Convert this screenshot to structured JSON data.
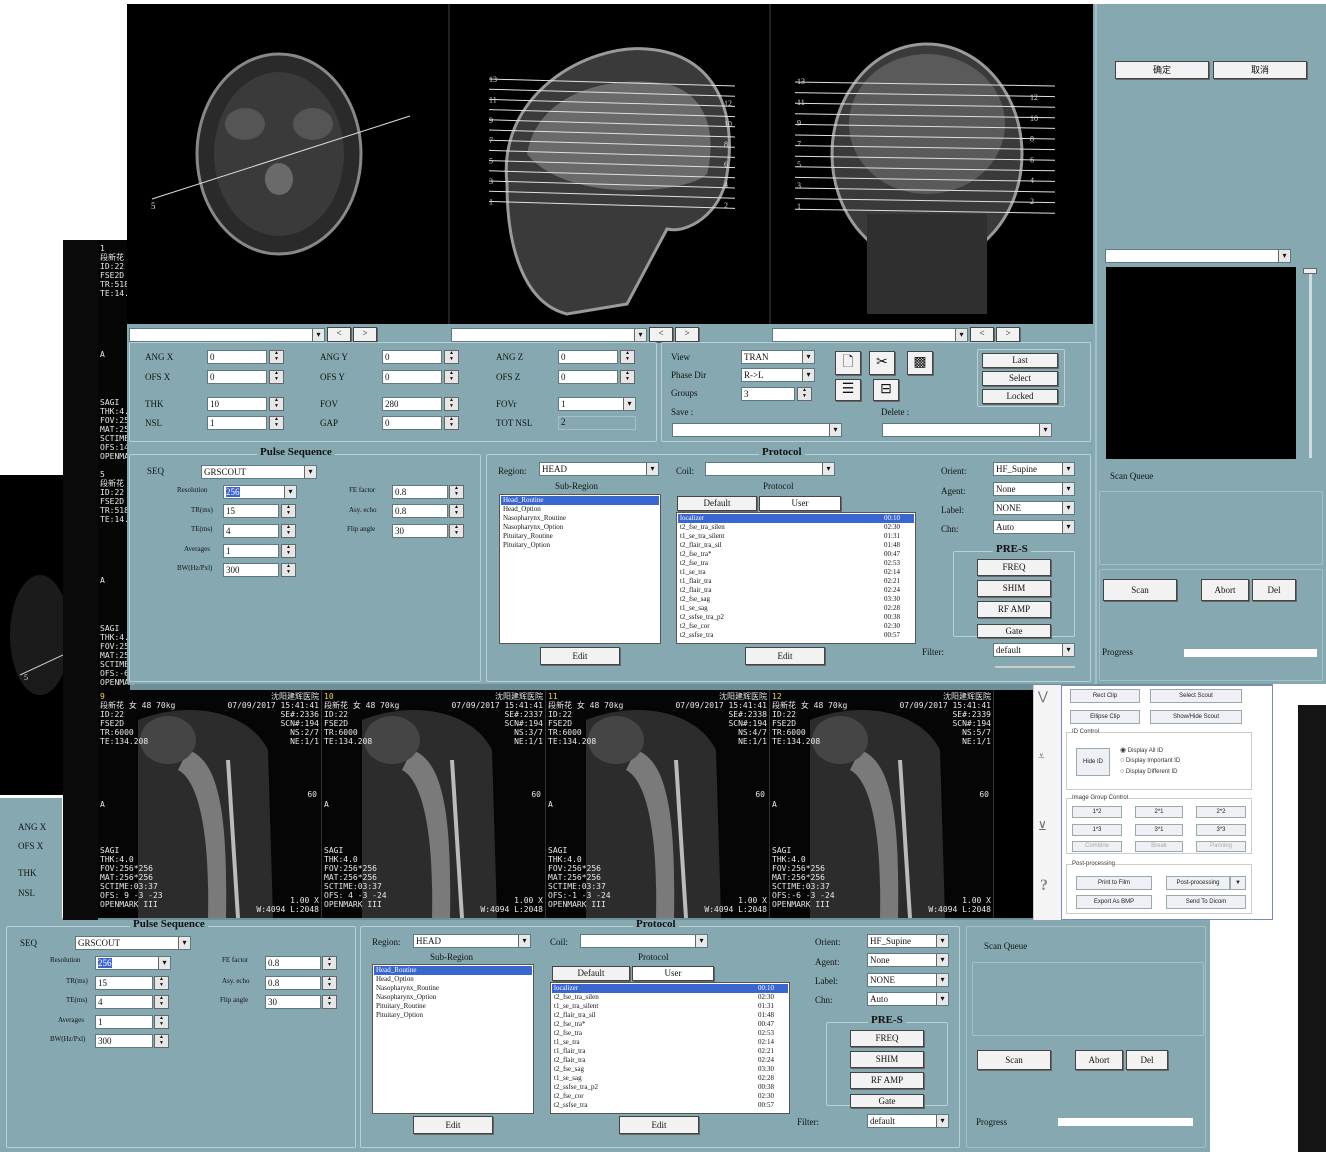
{
  "top_right": {
    "ok_label": "确定",
    "cancel_label": "取消",
    "scan_queue_label": "Scan Queue",
    "scan_label": "Scan",
    "abort_label": "Abort",
    "del_label": "Del",
    "progress_label": "Progress"
  },
  "planning": {
    "ang_x": "ANG X",
    "ang_x_val": "0",
    "ang_y": "ANG Y",
    "ang_y_val": "0",
    "ang_z": "ANG Z",
    "ang_z_val": "0",
    "ofs_x": "OFS X",
    "ofs_x_val": "0",
    "ofs_y": "OFS Y",
    "ofs_y_val": "0",
    "ofs_z": "OFS Z",
    "ofs_z_val": "0",
    "thk": "THK",
    "thk_val": "10",
    "fov": "FOV",
    "fov_val": "280",
    "fovr": "FOVr",
    "fovr_val": "1",
    "nsl": "NSL",
    "nsl_val": "1",
    "gap": "GAP",
    "gap_val": "0",
    "tot_nsl": "TOT NSL",
    "tot_nsl_val": "2",
    "view": "View",
    "view_val": "TRAN",
    "phase_dir": "Phase Dir",
    "phase_dir_val": "R->L",
    "groups": "Groups",
    "groups_val": "3",
    "save": "Save :",
    "delete": "Delete :",
    "last": "Last",
    "select": "Select",
    "locked": "Locked"
  },
  "pulse": {
    "title": "Pulse Sequence",
    "seq": "SEQ",
    "seq_val": "GRSCOUT",
    "resolution": "Resolution",
    "resolution_val": "256",
    "tr": "TR(ms)",
    "tr_val": "15",
    "te": "TE(ms)",
    "te_val": "4",
    "averages": "Averages",
    "averages_val": "1",
    "bw": "BW(Hz/Pxl)",
    "bw_val": "300",
    "fe": "FE factor",
    "fe_val": "0.8",
    "asy": "Asy. echo",
    "asy_val": "0.8",
    "flip": "Flip angle",
    "flip_val": "30"
  },
  "protocol": {
    "title": "Protocol",
    "region": "Region:",
    "region_val": "HEAD",
    "subregion": "Sub-Region",
    "coil": "Coil:",
    "protocol_hdr": "Protocol",
    "default": "Default",
    "user": "User",
    "edit": "Edit",
    "subregions": [
      "Head_Routine",
      "Head_Option",
      "Nasopharynx_Routine",
      "Nasopharynx_Option",
      "Pituitary_Routine",
      "Pituitary_Option"
    ],
    "items": [
      {
        "name": "localizer",
        "time": "00:10"
      },
      {
        "name": "t2_fse_tra_silen",
        "time": "02:30"
      },
      {
        "name": "t1_se_tra_silent",
        "time": "01:31"
      },
      {
        "name": "t2_flair_tra_sil",
        "time": "01:48"
      },
      {
        "name": "t2_fse_tra*",
        "time": "00:47"
      },
      {
        "name": "t2_fse_tra",
        "time": "02:53"
      },
      {
        "name": "t1_se_tra",
        "time": "02:14"
      },
      {
        "name": "t1_flair_tra",
        "time": "02:21"
      },
      {
        "name": "t2_flair_tra",
        "time": "02:24"
      },
      {
        "name": "t2_fse_sag",
        "time": "03:30"
      },
      {
        "name": "t1_se_sag",
        "time": "02:28"
      },
      {
        "name": "t2_ssfse_tra_p2",
        "time": "00:38"
      },
      {
        "name": "t2_fse_cor",
        "time": "02:30"
      },
      {
        "name": "t2_ssfse_tra",
        "time": "00:57"
      }
    ],
    "orient": "Orient:",
    "orient_val": "HF_Supine",
    "agent": "Agent:",
    "agent_val": "None",
    "label": "Label:",
    "label_val": "NONE",
    "chn": "Chn:",
    "chn_val": "Auto",
    "pres": "PRE-S",
    "freq": "FREQ",
    "shim": "SHIM",
    "rfamp": "RF AMP",
    "gate": "Gate",
    "filter": "Filter:",
    "filter_val": "default"
  },
  "slice_labels": {
    "sag_left": [
      "13",
      "11",
      "9",
      "7",
      "5",
      "3",
      "1"
    ],
    "sag_right": [
      "12",
      "10",
      "8",
      "6",
      "4",
      "2"
    ],
    "cor_left": [
      "13",
      "11",
      "9",
      "7",
      "5",
      "3",
      "1"
    ],
    "cor_right": [
      "12",
      "10",
      "8",
      "6",
      "4",
      "2"
    ],
    "axial": "5"
  },
  "left_strip": {
    "a1": "1\n段新花\nID:22\nFSE2D\nTR:518\nTE:14.",
    "a2": "SAGI\nTHK:4.\nFOV:25\nMAT:25\nSCTIME\nOFS:14\nOPENMAR",
    "b1": "5\n段新花\nID:22\nFSE2D\nTR:518\nTE:14.",
    "b2": "SAGI\nTHK:4.\nFOV:25\nMAT:25\nSCTIME\nOFS:-6\nOPENMAR",
    "a_mark": "A"
  },
  "series": [
    {
      "num": "9",
      "top": "段新花 女 48 70kg",
      "hosp": "沈阳建辉医院",
      "date": "07/09/2017 15:41:41",
      "scn": "SE#:2336\nSCN#:194\nNS:2/7\nNE:1/1",
      "ofs": "OFS: 9 -3 -23",
      "scale": "1.00 X",
      "wl": "W:4094 L:2048"
    },
    {
      "num": "10",
      "top": "段新花 女 48 70kg",
      "hosp": "沈阳建辉医院",
      "date": "07/09/2017 15:41:41",
      "scn": "SE#:2337\nSCN#:194\nNS:3/7\nNE:1/1",
      "ofs": "OFS: 4 -3 -24",
      "scale": "1.00 X",
      "wl": "W:4094 L:2048"
    },
    {
      "num": "11",
      "top": "段新花 女 48 70kg",
      "hosp": "沈阳建辉医院",
      "date": "07/09/2017 15:41:41",
      "scn": "SE#:2338\nSCN#:194\nNS:4/7\nNE:1/1",
      "ofs": "OFS:-1 -3 -24",
      "scale": "1.00 X",
      "wl": "W:4094 L:2048"
    },
    {
      "num": "12",
      "top": "段新花 女 48 70kg",
      "hosp": "沈阳建辉医院",
      "date": "07/09/2017 15:41:41",
      "scn": "SE#:2339\nSCN#:194\nNS:5/7\nNE:1/1",
      "ofs": "OFS:-6 -3 -24",
      "scale": "1.00 X",
      "wl": "W:4094 L:2048"
    }
  ],
  "series_common": {
    "id": "ID:22",
    "seq": "FSE2D",
    "tr": "TR:6000",
    "te": "TE:134.208",
    "sagi": "SAGI\nTHK:4.0\nFOV:256*256\nMAT:256*256\nSCTIME:03:37",
    "open": "OPENMARK III",
    "a": "A",
    "sixty": "60"
  },
  "tools": {
    "rect_clip": "Rect Clip",
    "select_scout": "Select Scout",
    "ellipse_clip": "Ellipse Clip",
    "show_hide_scout": "Show/Hide Scout",
    "id_control": "ID Control",
    "hide_id": "Hide ID",
    "display_all": "Display All ID",
    "display_important": "Display Important ID",
    "display_different": "Display Different ID",
    "image_group": "Image Group Control",
    "g12": "1*2",
    "g21": "2*1",
    "g22": "2*2",
    "g13": "1*3",
    "g31": "3*1",
    "g33": "3*3",
    "combine": "Combine",
    "break": "Break",
    "panning": "Panning",
    "post": "Post-processing",
    "print": "Print to Film",
    "postproc": "Post-processing",
    "export": "Export As BMP",
    "send": "Send To Dicom",
    "help": "?"
  },
  "bottom_left_small": {
    "ang_x": "ANG X",
    "ofs_x": "OFS X",
    "thk": "THK",
    "nsl": "NSL"
  }
}
